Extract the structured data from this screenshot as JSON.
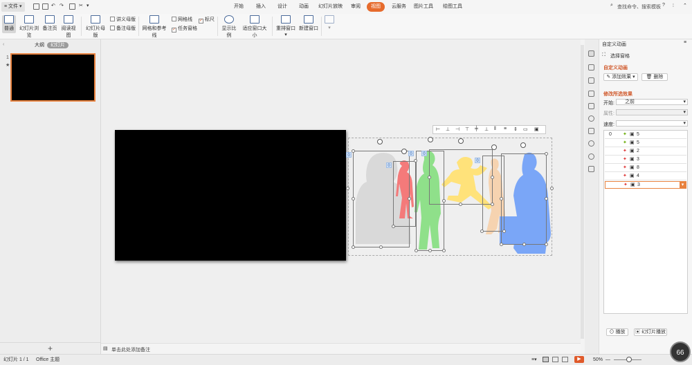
{
  "title_bar": {
    "file_menu": "文件",
    "tabs": [
      "开始",
      "插入",
      "设计",
      "动画",
      "幻灯片放映",
      "审阅",
      "视图",
      "云服务",
      "图片工具",
      "绘图工具"
    ],
    "active_tab": "视图",
    "search_placeholder": "查找命令、搜索模板",
    "help": "?"
  },
  "ribbon": {
    "normal": "普通",
    "slide_browse": "幻灯片浏览",
    "notes_page": "备注页",
    "reading_view": "阅读视图",
    "slide_master": "幻灯片母版",
    "handout_master": "讲义母版",
    "notes_master": "备注母版",
    "grid_guides": "网格和参考线",
    "gridlines": "网格线",
    "ruler": "标尺",
    "taskpane": "任务窗格",
    "zoom": "显示比例",
    "fit_window": "适应窗口大小",
    "arrange": "重排窗口",
    "new_window": "新建窗口"
  },
  "left_panel": {
    "tab_outline": "大纲",
    "tab_slides": "幻灯片",
    "slide_number": "1",
    "add_button": "+"
  },
  "canvas": {
    "tags": [
      "0",
      "0",
      "0",
      "0",
      "0"
    ]
  },
  "right_panel": {
    "title": "自定义动画",
    "select_pane": "选择窗格",
    "section_custom": "自定义动画",
    "add_effect": "添加效果",
    "delete": "删除",
    "section_modify": "修改所选效果",
    "start_label": "开始:",
    "start_value": "之前",
    "property_label": "属性:",
    "speed_label": "速度:",
    "effects": [
      {
        "order": "0",
        "name": "5"
      },
      {
        "order": "",
        "name": "5"
      },
      {
        "order": "",
        "name": "2"
      },
      {
        "order": "",
        "name": "3"
      },
      {
        "order": "",
        "name": "8"
      },
      {
        "order": "",
        "name": "4"
      },
      {
        "order": "",
        "name": "3"
      }
    ],
    "play": "播放",
    "slideshow": "幻灯片播放"
  },
  "notes": {
    "placeholder": "单击此处添加备注"
  },
  "status": {
    "slide": "幻灯片 1 / 1",
    "theme": "Office 主题",
    "zoom": "50%",
    "zoom_badge": "66"
  },
  "colors": {
    "accent": "#e66b2d",
    "slide_black": "#000000",
    "figure_gray": "#d9d9d9",
    "figure_red": "#f47a7a",
    "figure_green": "#8fe08a",
    "figure_yellow": "#ffe27a",
    "figure_peach": "#f6d3b0",
    "figure_blue": "#7aa6f7"
  }
}
